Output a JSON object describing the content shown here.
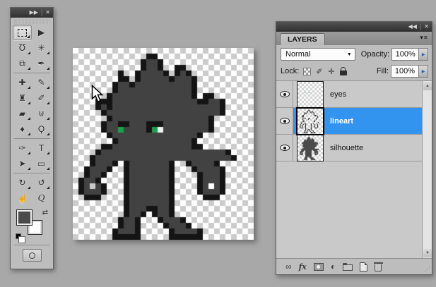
{
  "app": {
    "background": "#A8A8A8"
  },
  "tools_panel": {
    "collapse_icon": "▶▶",
    "separator": "|",
    "close_icon": "✕",
    "dividers_after": [
      5,
      13,
      17
    ],
    "tools": [
      {
        "name": "rectangular-marquee-tool",
        "glyph": "marquee",
        "selected": true,
        "flyout": true
      },
      {
        "name": "move-tool",
        "glyph": "▶",
        "selected": false,
        "flyout": false
      },
      {
        "name": "lasso-tool",
        "glyph": "℧",
        "selected": false,
        "flyout": true
      },
      {
        "name": "magic-wand-tool",
        "glyph": "✳",
        "selected": false,
        "flyout": true
      },
      {
        "name": "crop-tool",
        "glyph": "⧉",
        "selected": false,
        "flyout": true
      },
      {
        "name": "eyedropper-tool",
        "glyph": "✒",
        "selected": false,
        "flyout": true
      },
      {
        "name": "spot-healing-brush-tool",
        "glyph": "✚",
        "selected": false,
        "flyout": true
      },
      {
        "name": "pencil-tool",
        "glyph": "✎",
        "selected": false,
        "flyout": true
      },
      {
        "name": "clone-stamp-tool",
        "glyph": "♜",
        "selected": false,
        "flyout": true
      },
      {
        "name": "history-brush-tool",
        "glyph": "✐",
        "selected": false,
        "flyout": true
      },
      {
        "name": "eraser-tool",
        "glyph": "▰",
        "selected": false,
        "flyout": true
      },
      {
        "name": "paint-bucket-tool",
        "glyph": "⊍",
        "selected": false,
        "flyout": true
      },
      {
        "name": "blur-tool",
        "glyph": "♦",
        "selected": false,
        "flyout": true
      },
      {
        "name": "dodge-tool",
        "glyph": "Ϙ",
        "selected": false,
        "flyout": true
      },
      {
        "name": "pen-tool",
        "glyph": "✑",
        "selected": false,
        "flyout": true
      },
      {
        "name": "type-tool",
        "glyph": "T",
        "selected": false,
        "flyout": true
      },
      {
        "name": "path-selection-tool",
        "glyph": "➤",
        "selected": false,
        "flyout": true
      },
      {
        "name": "rectangle-tool",
        "glyph": "▭",
        "selected": false,
        "flyout": true
      },
      {
        "name": "3d-rotate-tool",
        "glyph": "↻",
        "selected": false,
        "flyout": true
      },
      {
        "name": "3d-orbit-tool",
        "glyph": "↺",
        "selected": false,
        "flyout": true
      },
      {
        "name": "hand-tool",
        "glyph": "☝",
        "selected": false,
        "flyout": false
      },
      {
        "name": "zoom-tool",
        "glyph": "Q",
        "selected": false,
        "flyout": false
      }
    ],
    "swap_colors_icon": "⇄",
    "foreground_color": "#4A4A4A",
    "background_color": "#FFFFFF"
  },
  "canvas": {
    "pixel_size": 8,
    "checker_light": "#FFFFFF",
    "checker_dark": "#CBCBCB",
    "sprite": {
      "palette": {
        "K": "#141414",
        "G": "#424242",
        "E": "#19A24A",
        "W": "#F2F2F2"
      },
      "rows": [
        "................................",
        ".............KK.................",
        "............KGGK................",
        "............KGGK..KK............",
        "........K..KGGGGK.KGK...........",
        "........KK.KGGGGGKGGGK..........",
        ".......KGGKGGGGGGGGGGK..........",
        ".......KGGGGGGGGGGGGGK..........",
        "......KGGGGGGGGGGGGGGK.KK.......",
        "....KKKGGGGGGGGGGGGGGGKKGGK.....",
        "....KGKGGGGGGGGGGGGGGGGGGGK.....",
        ".....KGGGGGGGGGGGGGGGGGGGGK.....",
        "......KGGGGGGGGGGGGGGGGGK.......",
        ".....KGGKKGGGKKKGGGGGGGGK.......",
        ".....KGGEGGGGKEWGGGGGGGGK.......",
        "......KGGGGGGGGGGGGGGGK.........",
        ".......KGGGGGGGGGGGGGK..........",
        ".....KKGGGGGGGGGGGGGGKK.........",
        "....KGGGGGGGGGGGGGGGGGGGGGGK....",
        "...KGGGGGGGGGGGGGGGGGGGGGGGGK...",
        "...KGGGK.KGGGGGGGK..KGGGGK......",
        "..KGGGK..KGGGGGGGK...KGGGGK.....",
        "..KGGK...KGGGGGGGK....KGGGK.....",
        ".KGGK....KGGGGGGGK....KGGGK.....",
        ".KG.GK...KGGGGGGGK....KG.GK.....",
        ".KGGGK...KGGGGGGGK....KGGGK.....",
        "..KKK....KGGGGGGGK.....KKK......",
        ".........KGGGGGGGK..............",
        ".........KGGGKKGGK..............",
        ".........KGGK.KGGK..............",
        "........KGGK...KGGGK............",
        "........KGGK....KGGGK...........",
        ".......KGGGK.....KGGGGK.........",
        ".......KKKKK.....KKKKKK........."
      ]
    }
  },
  "layers_panel": {
    "collapse_icon": "◀◀",
    "separator": "|",
    "close_icon": "✕",
    "tab_label": "LAYERS",
    "menu_icon": "▾≡",
    "blend_mode": "Normal",
    "blend_caret": "▼",
    "opacity_label": "Opacity:",
    "opacity_value": "100%",
    "fill_label": "Fill:",
    "fill_value": "100%",
    "spin_arrow": "▶",
    "lock_label": "Lock:",
    "lock_buttons": [
      {
        "name": "lock-transparent-pixels-button",
        "glyph": "css-checker"
      },
      {
        "name": "lock-image-pixels-button",
        "glyph": "✐"
      },
      {
        "name": "lock-position-button",
        "glyph": "✛"
      },
      {
        "name": "lock-all-button",
        "glyph": "css-lock"
      }
    ],
    "selected_color": "#3394F0",
    "layers": [
      {
        "name": "eyes",
        "visible": true,
        "selected": false,
        "thumb": "eyes"
      },
      {
        "name": "lineart",
        "visible": true,
        "selected": true,
        "thumb": "lineart"
      },
      {
        "name": "silhouette",
        "visible": true,
        "selected": false,
        "thumb": "silhouette"
      }
    ],
    "scrollbar": {
      "up": "▲",
      "down": "▼"
    },
    "footer_buttons": [
      {
        "name": "link-layers-button",
        "glyph": "∞"
      },
      {
        "name": "layer-styles-button",
        "glyph": "fx"
      },
      {
        "name": "add-layer-mask-button",
        "glyph": "css-mask"
      },
      {
        "name": "new-adjustment-layer-button",
        "glyph": "◐"
      },
      {
        "name": "new-group-button",
        "glyph": "css-folder"
      },
      {
        "name": "new-layer-button",
        "glyph": "css-newlayer"
      },
      {
        "name": "delete-layer-button",
        "glyph": "css-trash"
      }
    ],
    "grip_icon": "⋰"
  }
}
